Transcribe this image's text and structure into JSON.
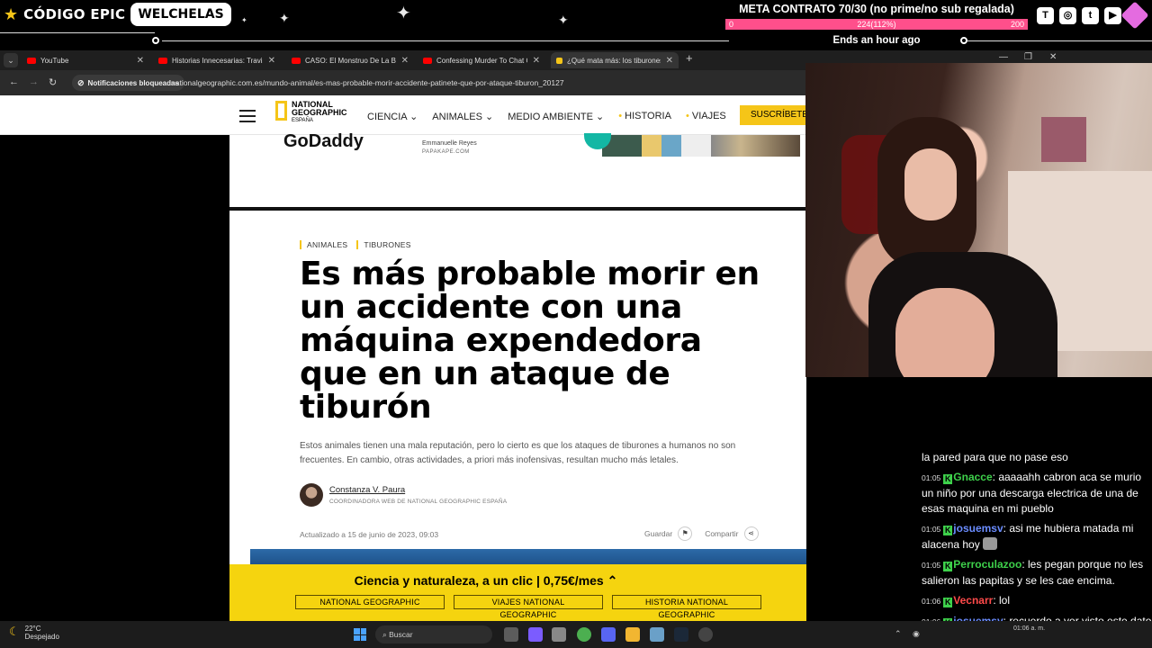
{
  "overlay": {
    "brand": "CÓDIGO EPIC",
    "channel": "WELCHELAS",
    "meta_title": "META CONTRATO 70/30 (no prime/no sub regalada)",
    "bar_min": "0",
    "bar_value": "224(112%)",
    "bar_max": "200",
    "bar_fill_fraction": 1.0,
    "ends": "Ends an hour ago"
  },
  "browser": {
    "tabs": [
      {
        "label": "YouTube"
      },
      {
        "label": "Historias Innecesarias: Travis el"
      },
      {
        "label": "CASO: El Monstruo De La Bicicl"
      },
      {
        "label": "Confessing Murder To Chat GP"
      },
      {
        "label": "¿Qué mata más: los tiburones o"
      }
    ],
    "notifications": "Notificaciones bloqueadas",
    "url": "nationalgeographic.com.es/mundo-animal/es-mas-probable-morir-accidente-patinete-que-por-ataque-tiburon_20127"
  },
  "site": {
    "logo_line1": "NATIONAL",
    "logo_line2": "GEOGRAPHIC",
    "logo_line3": "ESPAÑA",
    "nav": [
      "CIENCIA",
      "ANIMALES",
      "MEDIO AMBIENTE",
      "HISTORIA",
      "VIAJES"
    ],
    "subscribe": "SUSCRÍBETE"
  },
  "ad": {
    "brand": "GoDaddy",
    "name": "Emmanuelle Reyes",
    "sub": "PAPAKAPE.COM"
  },
  "article": {
    "crumbs": [
      "ANIMALES",
      "TIBURONES"
    ],
    "headline": "Es más probable morir en un accidente con una máquina expendedora que en un ataque de tiburón",
    "lead": "Estos animales tienen una mala reputación, pero lo cierto es que los ataques de tiburones a humanos no son frecuentes. En cambio, otras actividades, a priori más inofensivas, resultan mucho más letales.",
    "author": "Constanza V. Paura",
    "author_role": "COORDINADORA WEB DE NATIONAL GEOGRAPHIC ESPAÑA",
    "updated": "Actualizado a 15 de junio de 2023, 09:03",
    "save": "Guardar",
    "share": "Compartir"
  },
  "promo": {
    "title": "Ciencia y naturaleza, a un clic | 0,75€/mes",
    "links": [
      "NATIONAL GEOGRAPHIC",
      "VIAJES NATIONAL GEOGRAPHIC",
      "HISTORIA NATIONAL GEOGRAPHIC"
    ]
  },
  "chat": {
    "partial": "la pared para que no pase eso",
    "messages": [
      {
        "time": "01:05",
        "user": "Gnacce",
        "color": "#3ed14b",
        "text": "aaaaahh cabron aca se murio un niño por una descarga electrica de una de esas maquina en mi pueblo"
      },
      {
        "time": "01:05",
        "user": "josuemsv",
        "color": "#6a8cff",
        "text": "asi me hubiera matada mi alacena hoy"
      },
      {
        "time": "01:05",
        "user": "Perroculazoo",
        "color": "#3ed14b",
        "text": "les pegan porque no les salieron las papitas y se les cae encima."
      },
      {
        "time": "01:06",
        "user": "Vecnarr",
        "color": "#ff4a4a",
        "text": "lol"
      },
      {
        "time": "01:06",
        "user": "josuemsv",
        "color": "#6a8cff",
        "text": "recuerdo a ver visto este dato en uno de tus estrims"
      }
    ]
  },
  "taskbar": {
    "temp": "22°C",
    "weather": "Despejado",
    "search": "Buscar",
    "time": "01:06 a. m."
  }
}
